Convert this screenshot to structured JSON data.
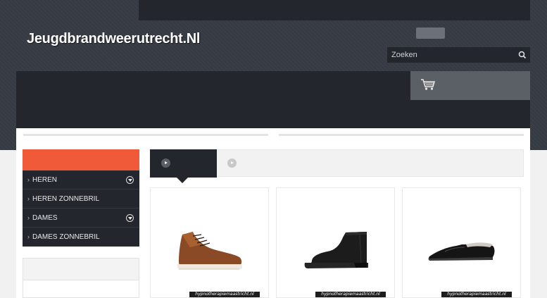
{
  "header": {
    "site_title": "Jeugdbrandweerutrecht.Nl",
    "search": {
      "placeholder": "Zoeken",
      "value": ""
    }
  },
  "icons": {
    "search": "search-icon",
    "cart": "shopping-cart-icon",
    "expand": "expand-circle-icon",
    "tab_play": "play-circle-icon"
  },
  "colors": {
    "accent": "#f05a38",
    "dark": "#23272d",
    "header": "#353a43"
  },
  "sidebar": {
    "categories": [
      {
        "label": "HEREN",
        "expandable": true
      },
      {
        "label": "HEREN ZONNEBRIL",
        "expandable": false
      },
      {
        "label": "DAMES",
        "expandable": true
      },
      {
        "label": "DAMES ZONNEBRIL",
        "expandable": false
      }
    ]
  },
  "products": [
    {
      "image": "brown-leather-high-top-sneaker",
      "watermark": "hypnotherapiemaastricht.nl"
    },
    {
      "image": "black-chelsea-boot",
      "watermark": "hypnotherapiemaastricht.nl"
    },
    {
      "image": "black-flat-slipper",
      "watermark": "hypnotherapiemaastricht.nl"
    }
  ]
}
